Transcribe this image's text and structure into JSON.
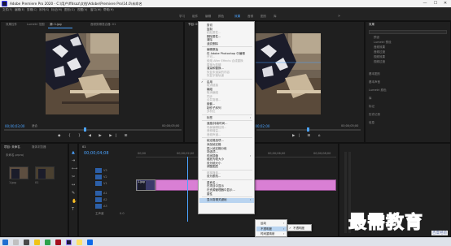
{
  "titlebar": {
    "title": "Adobe Premiere Pro 2020 - C:\\用户\\ffdsaz\\文档\\Adobe\\Premiere Pro\\14.0\\未命名",
    "minimize": "—",
    "maximize": "☐",
    "close": "✕"
  },
  "menubar": [
    "文件(F)",
    "编辑(E)",
    "剪辑(C)",
    "序列(S)",
    "标记(M)",
    "图形(G)",
    "视图(V)",
    "窗口(W)",
    "帮助(H)"
  ],
  "workspaces": [
    "学习",
    "组件",
    "编辑",
    "颜色",
    "效果",
    "音频",
    "图形",
    "库"
  ],
  "active_workspace": "效果",
  "source_panel": {
    "tabs": [
      "效果控件",
      "Lumetri 范围",
      "源: 1.jpg",
      "音频剪辑混合器: 01"
    ],
    "timecode_left": "00;00;03;00",
    "page": "适合",
    "timecode_right": "00;00;05;00"
  },
  "program_panel": {
    "tabs": [
      "节目: 01"
    ],
    "timecode_left": "00;00;02;00",
    "timecode_right": "00;00;05;00"
  },
  "effects_panel": {
    "title": "效果",
    "items": [
      "预设",
      "Lumetri 预设",
      "音频效果",
      "音频过渡",
      "视频效果",
      "视频过渡"
    ],
    "sections": [
      "基本图形",
      "基本声音",
      "Lumetri 颜色",
      "库",
      "标记",
      "历史记录",
      "信息"
    ]
  },
  "project_panel": {
    "tabs": [
      "项目: 未命名",
      "媒体浏览器"
    ],
    "filename": "未命名.prproj",
    "thumb_label_1": "1.jpg",
    "thumb_label_2": "01"
  },
  "timeline": {
    "title": "01",
    "timecode": "00;00;04;08",
    "ruler": [
      "00;00",
      "00;00;02;00",
      "00;00;04;00",
      "00;00;06;00",
      "00;00;08;00"
    ],
    "tracks": [
      "V3",
      "V2",
      "V1",
      "A1",
      "A2",
      "A3",
      "主声道"
    ],
    "clip_label": "1.jpg",
    "master_value": "0.0"
  },
  "context_menu": {
    "items": [
      {
        "label": "剪切",
        "disabled": false
      },
      {
        "label": "复制",
        "disabled": false
      },
      {
        "label": "粘贴属性...",
        "disabled": true
      },
      {
        "label": "删除属性...",
        "disabled": false
      },
      {
        "label": "清除",
        "disabled": false
      },
      {
        "label": "波纹删除",
        "disabled": false
      },
      {
        "sep": true
      },
      {
        "label": "编辑原始",
        "disabled": false
      },
      {
        "label": "在 Adobe Photoshop 中编辑",
        "disabled": false
      },
      {
        "label": "许可...",
        "disabled": true
      },
      {
        "label": "使用 After Effects 合成替换",
        "disabled": true
      },
      {
        "label": "替换为剪辑",
        "disabled": true
      },
      {
        "label": "渲染和替换...",
        "disabled": false
      },
      {
        "label": "恢复未渲染的内容",
        "disabled": true
      },
      {
        "label": "恢复字幕轨道",
        "disabled": true
      },
      {
        "sep": true
      },
      {
        "label": "启用",
        "disabled": false,
        "checked": true
      },
      {
        "label": "取消链接",
        "disabled": true
      },
      {
        "label": "编组",
        "disabled": false
      },
      {
        "label": "取消编组",
        "disabled": true
      },
      {
        "label": "同步",
        "disabled": true
      },
      {
        "label": "合并剪辑...",
        "disabled": true
      },
      {
        "label": "嵌套...",
        "disabled": false
      },
      {
        "label": "制作子序列",
        "disabled": false
      },
      {
        "label": "多机位",
        "disabled": true
      },
      {
        "sep": true
      },
      {
        "label": "标签",
        "disabled": false,
        "arrow": true
      },
      {
        "sep": true
      },
      {
        "label": "速度/持续时间...",
        "disabled": false
      },
      {
        "label": "场景编辑检测...",
        "disabled": true
      },
      {
        "label": "音频增益...",
        "disabled": true
      },
      {
        "label": "音频声道...",
        "disabled": true
      },
      {
        "sep": true
      },
      {
        "label": "帧定格选项...",
        "disabled": false
      },
      {
        "label": "添加帧定格",
        "disabled": false
      },
      {
        "label": "插入帧定格分段",
        "disabled": false
      },
      {
        "label": "场选项...",
        "disabled": false
      },
      {
        "label": "时间插值",
        "disabled": false,
        "arrow": true
      },
      {
        "label": "缩放为帧大小",
        "disabled": false
      },
      {
        "label": "设为帧大小",
        "disabled": false
      },
      {
        "label": "调整图层",
        "disabled": false
      },
      {
        "sep": true
      },
      {
        "label": "链接媒体...",
        "disabled": true
      },
      {
        "label": "设为脱机...",
        "disabled": false
      },
      {
        "sep": true
      },
      {
        "label": "重命名...",
        "disabled": false
      },
      {
        "label": "在项目中显示",
        "disabled": false
      },
      {
        "label": "在资源管理器中显示...",
        "disabled": false
      },
      {
        "label": "属性",
        "disabled": false
      },
      {
        "sep": true
      },
      {
        "label": "显示剪辑关键帧",
        "disabled": false,
        "arrow": true,
        "highlighted": true
      }
    ]
  },
  "submenu1": {
    "items": [
      {
        "label": "运动",
        "arrow": true
      },
      {
        "label": "不透明度",
        "arrow": true,
        "highlighted": true
      },
      {
        "label": "时间重映射",
        "arrow": true
      }
    ]
  },
  "submenu2": {
    "items": [
      {
        "label": "不透明度",
        "checked": true
      }
    ]
  },
  "watermark": {
    "main": "最需教育",
    "sub": "百度经验"
  }
}
